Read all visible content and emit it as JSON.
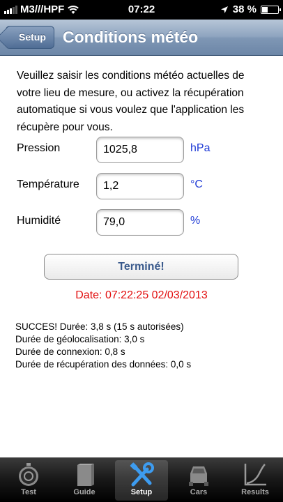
{
  "status_bar": {
    "carrier": "M3///HPF",
    "time": "07:22",
    "battery": "38 %",
    "battery_level": 0.38
  },
  "nav": {
    "back_label": "Setup",
    "title": "Conditions météo"
  },
  "intro_text": "Veuillez saisir les conditions météo actuelles de votre lieu de mesure, ou activez la récupération automatique si vous voulez que l'application les récupère pour vous.",
  "fields": [
    {
      "label": "Pression",
      "value": "1025,8",
      "unit": "hPa"
    },
    {
      "label": "Température",
      "value": "1,2",
      "unit": "°C"
    },
    {
      "label": "Humidité",
      "value": "79,0",
      "unit": "%"
    }
  ],
  "done_label": "Terminé!",
  "date_text": "Date: 07:22:25 02/03/2013",
  "log_lines": [
    "SUCCES! Durée: 3,8 s (15 s autorisées)",
    "Durée de géolocalisation: 3,0 s",
    "Durée de connexion: 0,8 s",
    "Durée de récupération des données: 0,0 s"
  ],
  "tabs": [
    {
      "label": "Test",
      "icon": "stopwatch-icon"
    },
    {
      "label": "Guide",
      "icon": "book-icon"
    },
    {
      "label": "Setup",
      "icon": "tools-icon",
      "active": true
    },
    {
      "label": "Cars",
      "icon": "car-icon"
    },
    {
      "label": "Results",
      "icon": "chart-icon"
    }
  ]
}
